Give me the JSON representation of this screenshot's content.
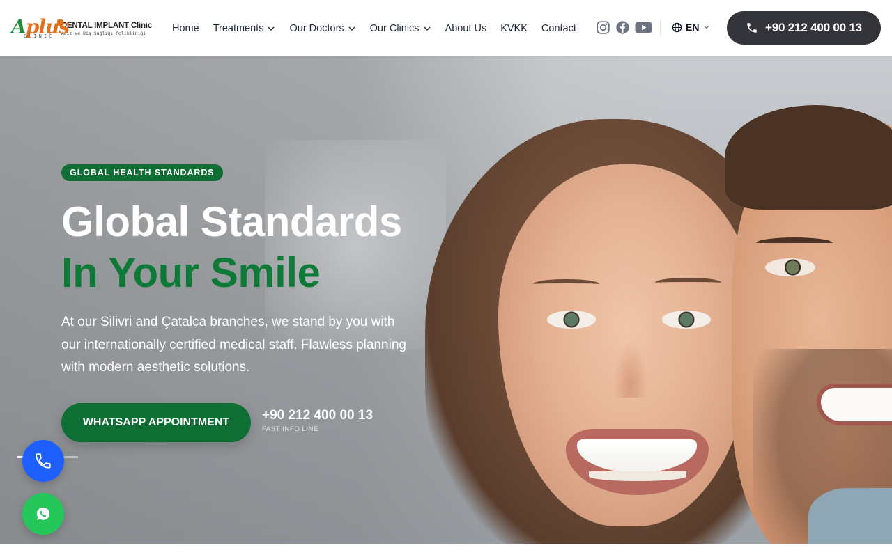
{
  "logo": {
    "brand": "Aplus",
    "brand_sub": "CLINIC",
    "line1": "DENTAL IMPLANT Clinic",
    "line2": "Ağız ve Diş Sağlığı Polikliniği"
  },
  "nav": {
    "items": [
      {
        "label": "Home",
        "has_dropdown": false
      },
      {
        "label": "Treatments",
        "has_dropdown": true
      },
      {
        "label": "Our Doctors",
        "has_dropdown": true
      },
      {
        "label": "Our Clinics",
        "has_dropdown": true
      },
      {
        "label": "About Us",
        "has_dropdown": false
      },
      {
        "label": "KVKK",
        "has_dropdown": false
      },
      {
        "label": "Contact",
        "has_dropdown": false
      }
    ]
  },
  "socials": [
    "instagram-icon",
    "facebook-icon",
    "youtube-icon"
  ],
  "language": {
    "current": "EN"
  },
  "header_phone": "+90 212 400 00 13",
  "hero": {
    "badge": "GLOBAL HEALTH STANDARDS",
    "title_line1": "Global Standards",
    "title_line2": "In Your Smile",
    "description": "At our Silivri and Çatalca branches, we stand by you with our internationally certified medical staff. Flawless planning with modern aesthetic solutions.",
    "cta_label": "WHATSAPP APPOINTMENT",
    "phone": "+90 212 400 00 13",
    "phone_sub": "FAST INFO LINE"
  },
  "colors": {
    "brand_green": "#0f6e33",
    "title_green": "#0f7a38",
    "dark_button": "#34353a",
    "call_blue": "#1f5eff",
    "whatsapp_green": "#25c75a"
  }
}
